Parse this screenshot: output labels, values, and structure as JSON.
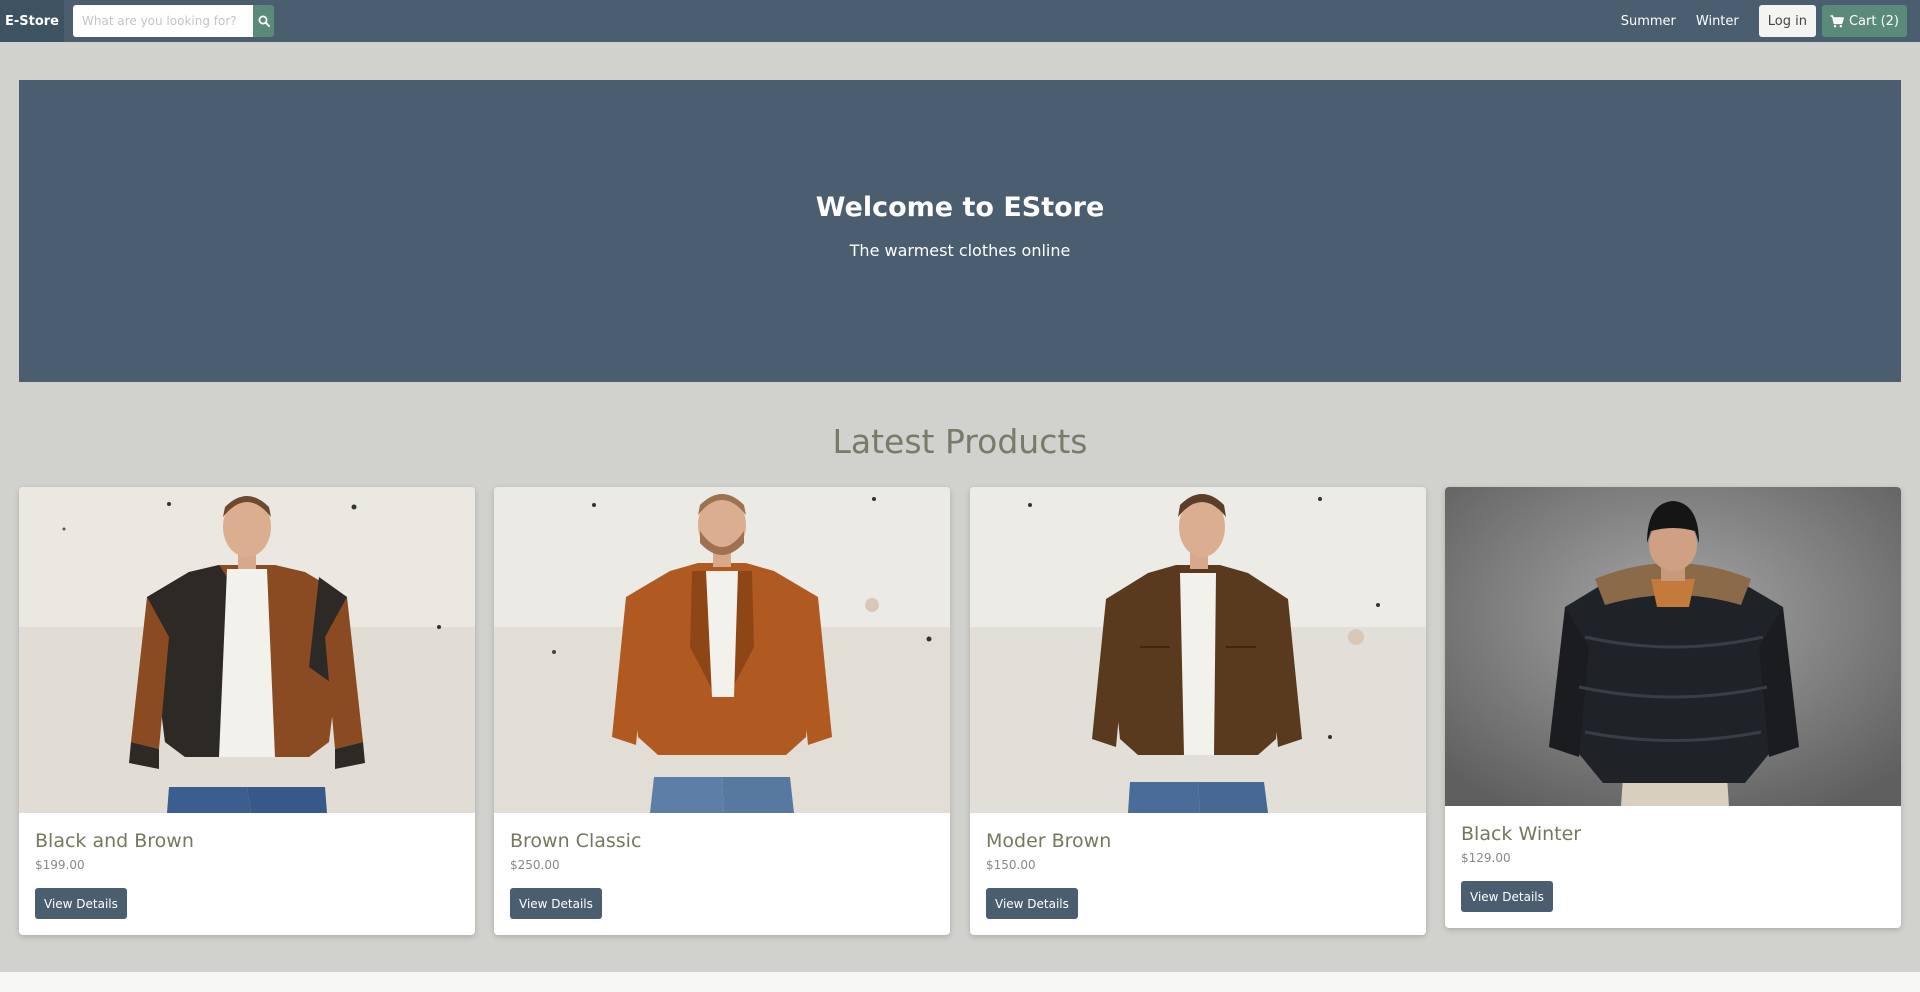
{
  "nav": {
    "brand": "E-Store",
    "search_placeholder": "What are you looking for?",
    "links": [
      "Summer",
      "Winter"
    ],
    "login_label": "Log in",
    "cart_label": "Cart (2)"
  },
  "hero": {
    "title": "Welcome to EStore",
    "subtitle": "The warmest clothes online"
  },
  "products_section": {
    "title": "Latest Products",
    "items": [
      {
        "name": "Black and Brown",
        "price": "$199.00",
        "button": "View Details",
        "image_icon": "leather-jacket-photo"
      },
      {
        "name": "Brown Classic",
        "price": "$250.00",
        "button": "View Details",
        "image_icon": "suede-jacket-photo"
      },
      {
        "name": "Moder Brown",
        "price": "$150.00",
        "button": "View Details",
        "image_icon": "brown-jacket-photo"
      },
      {
        "name": "Black Winter",
        "price": "$129.00",
        "button": "View Details",
        "image_icon": "puffer-jacket-photo"
      }
    ]
  },
  "colors": {
    "navbar": "#4a5e70",
    "accent": "#5a8a7a",
    "page_bg": "#d1d1cd"
  }
}
